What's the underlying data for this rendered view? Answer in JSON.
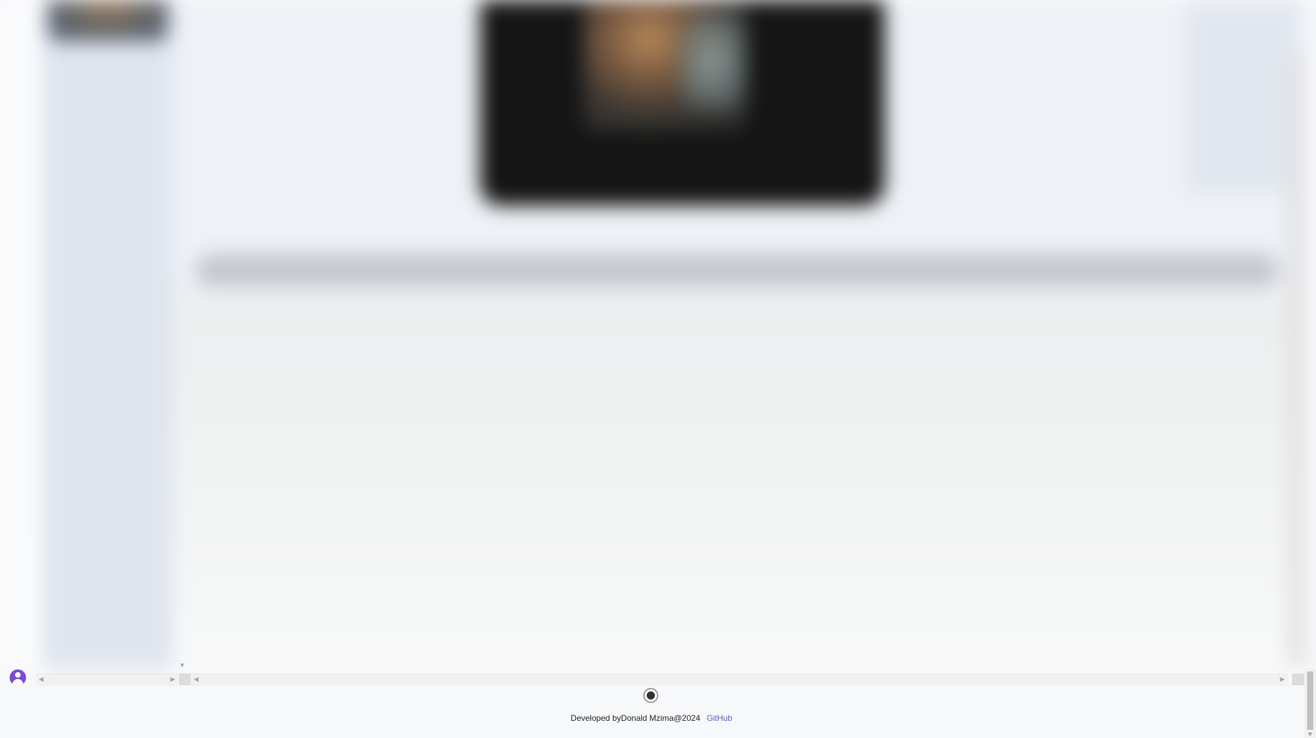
{
  "footer": {
    "credit_text": "Developed byDonald Mzima@2024",
    "github_link": "GitHub"
  },
  "icons": {
    "user": "user-avatar-icon",
    "record": "record-icon"
  },
  "colors": {
    "accent": "#7b4bd6",
    "link": "#5b5fc7"
  }
}
